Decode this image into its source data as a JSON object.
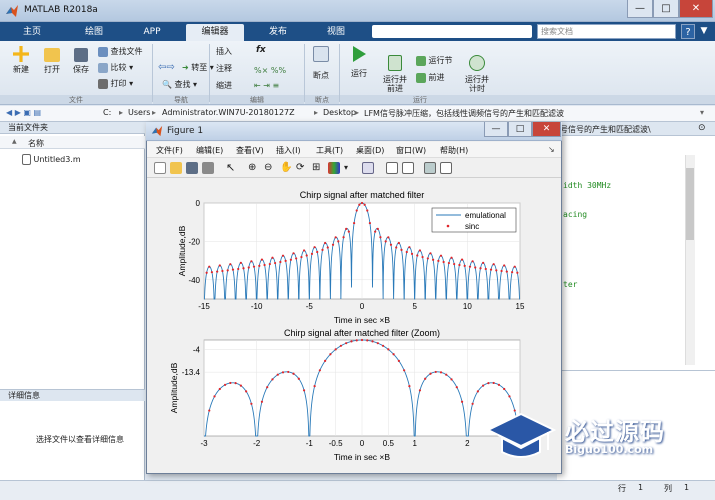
{
  "window": {
    "title": "MATLAB R2018a",
    "minimize": "—",
    "maximize": "□",
    "close": "✕"
  },
  "tabs": [
    {
      "label": "主页",
      "active": false
    },
    {
      "label": "绘图",
      "active": false
    },
    {
      "label": "APP",
      "active": false
    },
    {
      "label": "编辑器",
      "active": true
    },
    {
      "label": "发布",
      "active": false
    },
    {
      "label": "视图",
      "active": false
    }
  ],
  "search": {
    "placeholder": "搜索文档"
  },
  "ribbon": {
    "new": "新建",
    "open": "打开",
    "save": "保存",
    "find_files": "查找文件",
    "compare": "比较",
    "print": "打印",
    "insert": "插入",
    "fx": "fx",
    "comment": "注释",
    "indent": "缩进",
    "goto": "转至",
    "find": "查找",
    "breakpoints": "断点",
    "run": "运行",
    "run_advance": "运行并\n前进",
    "run_section": "运行节",
    "advance": "前进",
    "run_time": "运行并\n计时",
    "groups": [
      "文件",
      "导航",
      "编辑",
      "断点",
      "运行"
    ]
  },
  "address": {
    "segments": [
      "C:",
      "Users",
      "Administrator.WIN7U-20180127Z",
      "Desktop",
      "LFM信号脉冲压缩，包括线性调频信号的产生和匹配滤波"
    ]
  },
  "left": {
    "folder_title": "当前文件夹",
    "col_name": "名称",
    "col_sort": "▲",
    "files": [
      "Untitled3.m"
    ],
    "details_title": "详细信息",
    "details_msg": "选择文件以查看详细信息"
  },
  "editor": {
    "title_partial": "号信号的产生和匹配滤波\\",
    "lines": [
      {
        "text": "idth 30MHz",
        "color": "#228b22"
      },
      {
        "text": "acing",
        "color": "#228b22"
      },
      {
        "text": "ter",
        "color": "#228b22"
      }
    ]
  },
  "status": {
    "row_label": "行",
    "row_value": "1",
    "col_label": "列",
    "col_value": "1"
  },
  "figure": {
    "title": "Figure 1",
    "menus": [
      "文件(F)",
      "编辑(E)",
      "查看(V)",
      "插入(I)",
      "工具(T)",
      "桌面(D)",
      "窗口(W)",
      "帮助(H)"
    ]
  },
  "watermark": {
    "text": "必过源码",
    "url": "Biguo100.com"
  },
  "chart_data": [
    {
      "type": "line",
      "title": "Chirp signal after matched filter",
      "xlabel": "Time in sec ×B",
      "ylabel": "Amplitude,dB",
      "xlim": [
        -15,
        15
      ],
      "ylim": [
        -50,
        0
      ],
      "xticks": [
        "-15",
        "-10",
        "-5",
        "0",
        "5",
        "10",
        "15"
      ],
      "yticks": [
        "0",
        "-20",
        "-40"
      ],
      "legend": {
        "position": "top-right",
        "entries": [
          "emulational",
          "sinc"
        ]
      },
      "series": [
        {
          "name": "emulational",
          "color": "#2a7ab9",
          "style": "line"
        },
        {
          "name": "sinc",
          "color": "#e0262b",
          "style": "dots"
        }
      ],
      "formula": "20*log10(|sinc(x)|)"
    },
    {
      "type": "line",
      "title": "Chirp signal after matched filter (Zoom)",
      "xlabel": "Time in sec ×B",
      "ylabel": "Amplitude,dB",
      "xlim": [
        -3,
        3
      ],
      "ylim": [
        -40,
        0
      ],
      "xticks": [
        "-3",
        "-2",
        "-1",
        "-0.5",
        "0",
        "0.5",
        "1",
        "2",
        "3"
      ],
      "yticks": [
        "-4",
        "-13.4"
      ],
      "series": [
        {
          "name": "emulational",
          "color": "#2a7ab9",
          "style": "line"
        },
        {
          "name": "sinc",
          "color": "#e0262b",
          "style": "dots"
        }
      ],
      "formula": "20*log10(|sinc(x)|)"
    }
  ]
}
